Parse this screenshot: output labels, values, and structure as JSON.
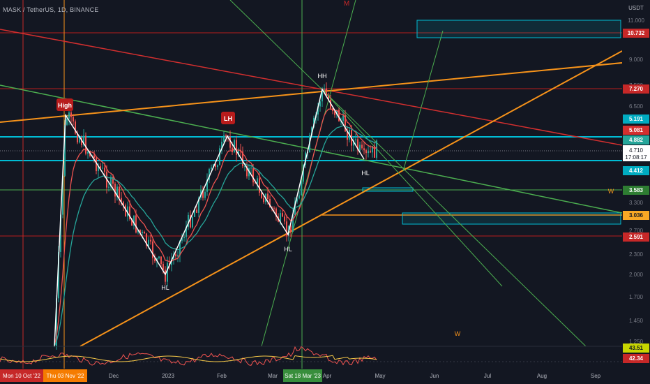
{
  "header": {
    "symbol": "MASK / TetherUS, 1D, BINANCE",
    "m_label": "M"
  },
  "price_axis": {
    "unit": "USDT",
    "ticks": [
      "11.000",
      "9.000",
      "7.500",
      "6.500",
      "5.400",
      "3.900",
      "3.300",
      "2.700",
      "2.300",
      "2.000",
      "1.700",
      "1.450",
      "1.250"
    ],
    "current_price": "4.710",
    "countdown": "17:08:17",
    "badges": [
      {
        "text": "10.732",
        "color": "#c62828"
      },
      {
        "text": "7.270",
        "color": "#c62828"
      },
      {
        "text": "5.191",
        "color": "#00acc1"
      },
      {
        "text": "5.081",
        "color": "#d32f2f"
      },
      {
        "text": "4.882",
        "color": "#26a69a"
      },
      {
        "text": "4.412",
        "color": "#00acc1"
      },
      {
        "text": "3.583",
        "color": "#2e7d32"
      },
      {
        "text": "3.036",
        "color": "#f9a825"
      },
      {
        "text": "2.591",
        "color": "#c62828"
      },
      {
        "text": "43.51",
        "color": "#c8d600"
      },
      {
        "text": "42.34",
        "color": "#c62828"
      }
    ]
  },
  "time_axis": {
    "labels": [
      "Dec",
      "2023",
      "Feb",
      "Mar",
      "Apr",
      "May",
      "Jun",
      "Jul",
      "Aug",
      "Sep"
    ],
    "badges": [
      {
        "text": "Mon 10 Oct '22",
        "color": "#c62828"
      },
      {
        "text": "Thu 03 Nov '22",
        "color": "#f57c00"
      },
      {
        "text": "Sat 18 Mar '23",
        "color": "#388e3c"
      }
    ]
  },
  "annotations": {
    "high_marker": "High",
    "lh_marker": "LH",
    "hh": "HH",
    "hl_right": "HL",
    "hl_dec": "HL",
    "hl_mar": "HL",
    "w_right": "W",
    "w_bottom": "W"
  },
  "colors": {
    "background": "#131722",
    "up": "#26a69a",
    "down": "#ef5350",
    "trend_orange": "#f7931a",
    "trend_red": "#c62828",
    "trend_green": "#4caf50",
    "zone_cyan": "#00bcd4"
  }
}
